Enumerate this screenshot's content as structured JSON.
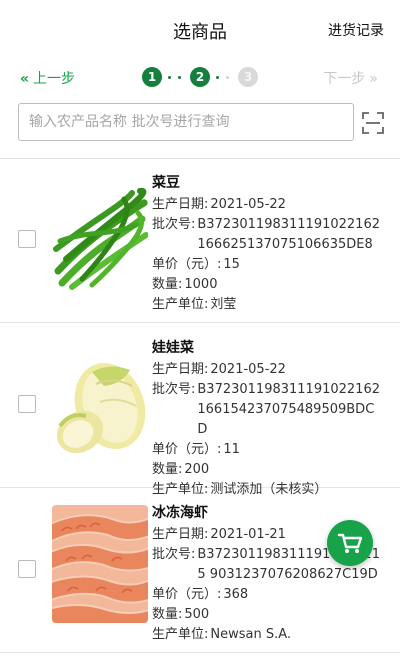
{
  "header": {
    "title": "选商品",
    "history_label": "进货记录"
  },
  "steps": {
    "prev_label": "上一步",
    "next_label": "下一步",
    "items": [
      "1",
      "2",
      "3"
    ]
  },
  "search": {
    "placeholder": "输入农产品名称 批次号进行查询"
  },
  "labels": {
    "production_date": "生产日期:",
    "batch_no": "批次号:",
    "unit_price": "单价（元）:",
    "quantity": "数量:",
    "producer": "生产单位:"
  },
  "products": [
    {
      "name": "菜豆",
      "production_date": "2021-05-22",
      "batch_no": "B372301198311191022162166625137075106635DE8",
      "unit_price": "15",
      "quantity": "1000",
      "producer": "刘莹",
      "image": "green-beans"
    },
    {
      "name": "娃娃菜",
      "production_date": "2021-05-22",
      "batch_no": "B372301198311191022162166154237075489509BDCD",
      "unit_price": "11",
      "quantity": "200",
      "producer": "测试添加（未核实）",
      "image": "baby-cabbage"
    },
    {
      "name": "冰冻海虾",
      "production_date": "2021-01-21",
      "batch_no": "B3723011983111910⁠2⁠16⁠2⁠15 9031237076208627C19D",
      "unit_price": "368",
      "quantity": "500",
      "producer": "Newsan S.A.",
      "image": "frozen-shrimp"
    }
  ],
  "colors": {
    "accent": "#15803d",
    "fab": "#18a34a",
    "disabled": "#c8c8c8"
  }
}
